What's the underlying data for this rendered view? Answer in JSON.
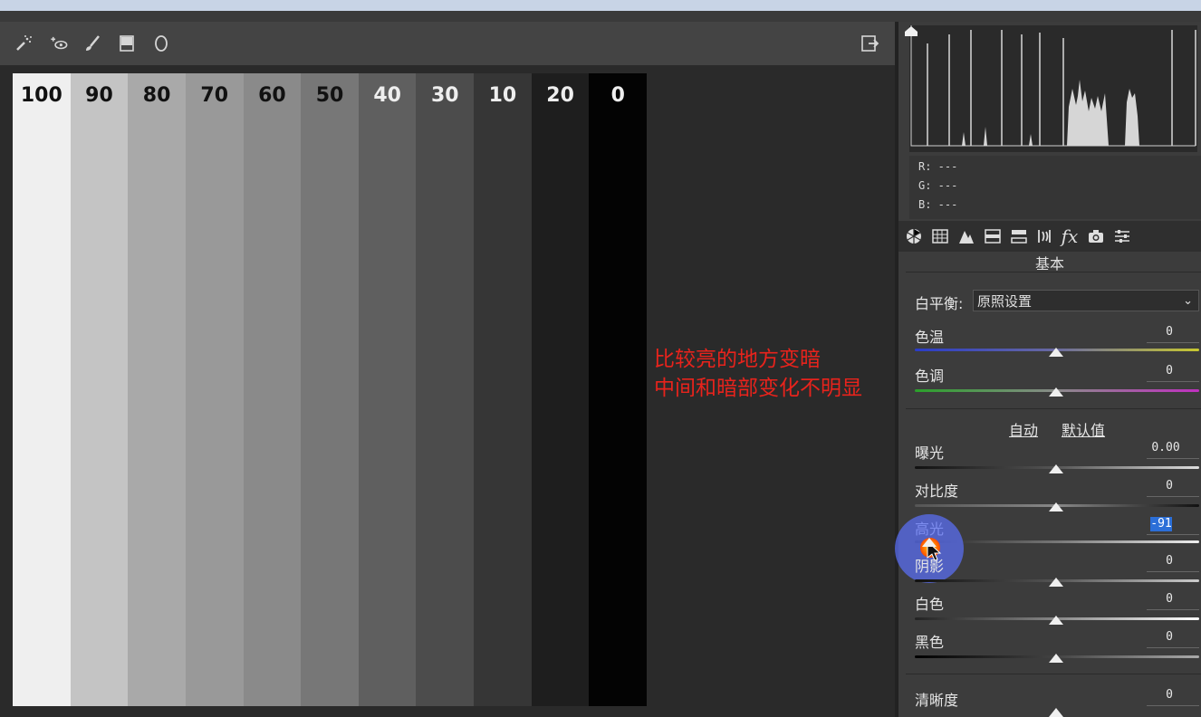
{
  "toolbar": {
    "tools": [
      "spot-heal-icon",
      "red-eye-icon",
      "brush-icon",
      "gradient-icon",
      "radial-filter-icon"
    ],
    "right_tool": "open-export-icon"
  },
  "preview": {
    "strips": [
      {
        "label": "100",
        "bg": "#efefef",
        "fg": "#111111"
      },
      {
        "label": "90",
        "bg": "#c4c4c4",
        "fg": "#111111"
      },
      {
        "label": "80",
        "bg": "#a9a9a9",
        "fg": "#111111"
      },
      {
        "label": "70",
        "bg": "#999999",
        "fg": "#111111"
      },
      {
        "label": "60",
        "bg": "#8a8a8a",
        "fg": "#111111"
      },
      {
        "label": "50",
        "bg": "#777777",
        "fg": "#111111"
      },
      {
        "label": "40",
        "bg": "#5f5f5f",
        "fg": "#eeeeee"
      },
      {
        "label": "30",
        "bg": "#4c4c4c",
        "fg": "#eeeeee"
      },
      {
        "label": "10",
        "bg": "#363636",
        "fg": "#eeeeee"
      },
      {
        "label": "20",
        "bg": "#1e1e1e",
        "fg": "#eeeeee"
      },
      {
        "label": "0",
        "bg": "#030303",
        "fg": "#eeeeee"
      }
    ]
  },
  "annotation": {
    "line1": "比较亮的地方变暗",
    "line2": "中间和暗部变化不明显",
    "color": "#e8231c"
  },
  "rgb": {
    "r": "R:  ---",
    "g": "G:  ---",
    "b": "B:  ---"
  },
  "panel": {
    "title": "基本",
    "white_balance_label": "白平衡:",
    "white_balance_value": "原照设置",
    "auto_label": "自动",
    "default_label": "默认值",
    "sliders": {
      "temp": {
        "label": "色温",
        "value": "0"
      },
      "tint": {
        "label": "色调",
        "value": "0"
      },
      "exposure": {
        "label": "曝光",
        "value": "0.00"
      },
      "contrast": {
        "label": "对比度",
        "value": "0"
      },
      "highlights": {
        "label": "高光",
        "value": "-91"
      },
      "shadows": {
        "label": "阴影",
        "value": "0"
      },
      "whites": {
        "label": "白色",
        "value": "0"
      },
      "blacks": {
        "label": "黑色",
        "value": "0"
      },
      "clarity": {
        "label": "清晰度",
        "value": "0"
      }
    }
  }
}
